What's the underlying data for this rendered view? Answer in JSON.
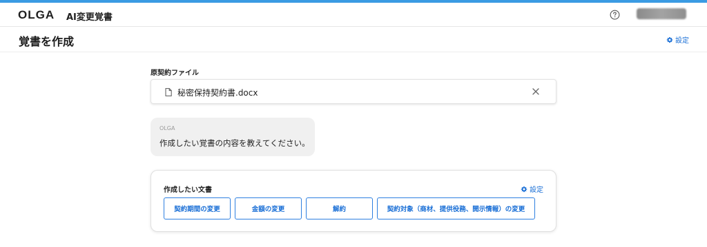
{
  "colors": {
    "accent": "#3b9be3",
    "link": "#1a6fd6",
    "bubble": "#f0f0f0"
  },
  "header": {
    "logo": "OLGA",
    "product_name": "AI変更覚書",
    "help_icon": "question-circle-icon",
    "avatar_icon": "user-avatar"
  },
  "page": {
    "title": "覚書を作成",
    "settings_label": "設定"
  },
  "original_file": {
    "label": "原契約ファイル",
    "file_name": "秘密保持契約書.docx",
    "file_icon": "document-icon",
    "remove_icon": "close-icon"
  },
  "chat": {
    "sender": "OLGA",
    "message": "作成したい覚書の内容を教えてください。"
  },
  "document_type": {
    "title": "作成したい文書",
    "settings_label": "設定",
    "options": [
      "契約期間の変更",
      "金額の変更",
      "解約",
      "契約対象（商材、提供役務、開示情報）の変更"
    ]
  }
}
